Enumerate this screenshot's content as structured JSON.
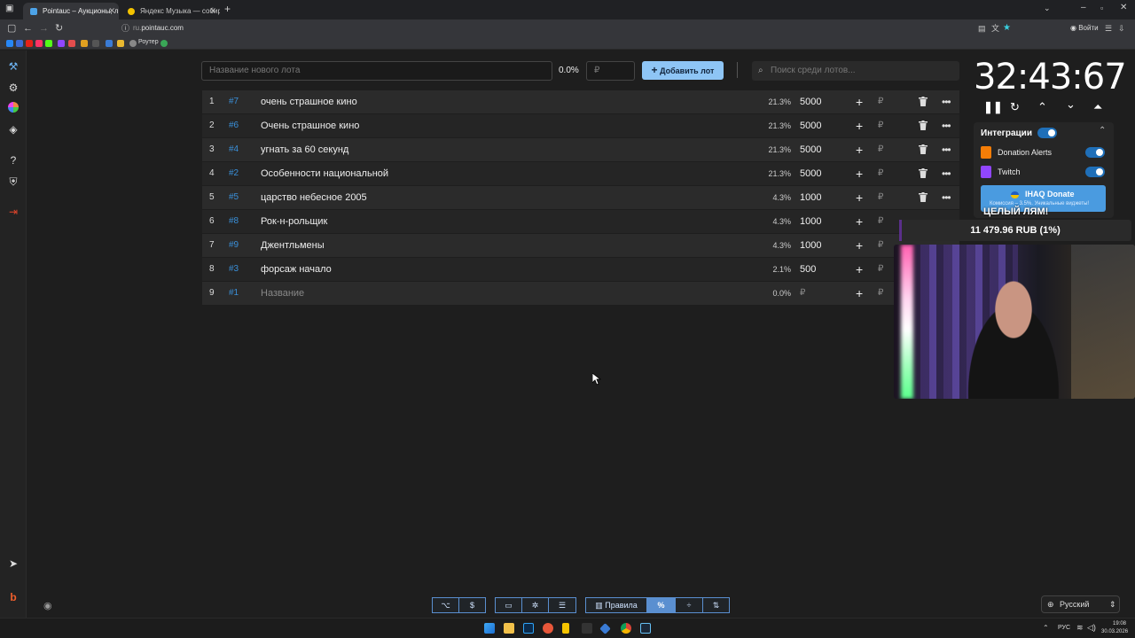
{
  "browser": {
    "tabs": [
      {
        "label": "Pointauc – Аукционы, лотерея",
        "active": true
      },
      {
        "label": "Яндекс Музыка — собирае",
        "active": false
      }
    ],
    "url_prefix": "ru.",
    "url_domain": "pointauc.com",
    "signin_label": "Войти",
    "bookmark_label": "Роутер"
  },
  "lot_form": {
    "name_placeholder": "Название нового лота",
    "percent": "0.0%",
    "amount_placeholder": "₽",
    "add_button": "Добавить лот",
    "search_placeholder": "Поиск среди лотов..."
  },
  "lots": [
    {
      "num": "1",
      "tag": "#7",
      "name": "очень страшное кино",
      "pct": "21.3%",
      "amount": "5000"
    },
    {
      "num": "2",
      "tag": "#6",
      "name": "Очень страшное кино",
      "pct": "21.3%",
      "amount": "5000"
    },
    {
      "num": "3",
      "tag": "#4",
      "name": "угнать за 60 секунд",
      "pct": "21.3%",
      "amount": "5000"
    },
    {
      "num": "4",
      "tag": "#2",
      "name": "Особенности национальной",
      "pct": "21.3%",
      "amount": "5000"
    },
    {
      "num": "5",
      "tag": "#5",
      "name": "царство небесное 2005",
      "pct": "4.3%",
      "amount": "1000"
    },
    {
      "num": "6",
      "tag": "#8",
      "name": "Рок-н-рольщик",
      "pct": "4.3%",
      "amount": "1000"
    },
    {
      "num": "7",
      "tag": "#9",
      "name": "Джентльмены",
      "pct": "4.3%",
      "amount": "1000"
    },
    {
      "num": "8",
      "tag": "#3",
      "name": "форсаж начало",
      "pct": "2.1%",
      "amount": "500"
    },
    {
      "num": "9",
      "tag": "#1",
      "name": "Название",
      "pct": "0.0%",
      "amount": "₽",
      "placeholder": true
    }
  ],
  "rub_sign": "₽",
  "timer": {
    "value": "32:43:67"
  },
  "integrations": {
    "title": "Интеграции",
    "items": [
      {
        "label": "Donation Alerts",
        "enabled": true
      },
      {
        "label": "Twitch",
        "enabled": true
      }
    ],
    "donate_label": "IHAQ Donate",
    "donate_sub": "Комиссия – 3.5%. Уникальные виджеты!"
  },
  "overlay": {
    "title": "ЦЕЛЫЙ ЛЯМ!",
    "goal": "11 479.96 RUB (1%)",
    "goal_progress": 0.01
  },
  "bottom": {
    "rules_label": "Правила",
    "currency_symbol": "$",
    "percent_symbol": "%"
  },
  "language": {
    "selected": "Русский"
  },
  "taskbar": {
    "lang": "РУС",
    "time": "19:08",
    "date": "30.03.2026"
  },
  "colors": {
    "accent": "#8ec5f5",
    "tag": "#3a8fd8",
    "toggle": "#1f6fb8"
  }
}
